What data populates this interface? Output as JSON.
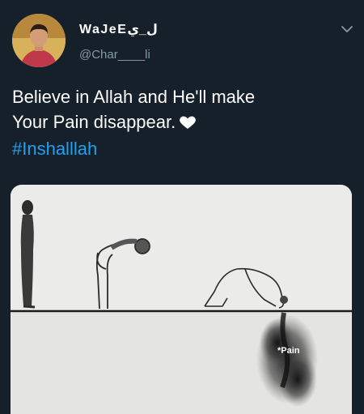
{
  "tweet": {
    "display_name": "WaJeEل_ي",
    "handle": "@Char____li",
    "text_line_1": "Believe in Allah and He'll make",
    "text_line_2": "Your Pain disappear.",
    "hashtag": "#Inshalllah",
    "heart_icon": "heart-icon",
    "menu_icon": "chevron-down-icon"
  },
  "media": {
    "pain_label": "*Pain"
  },
  "colors": {
    "background": "#15202b",
    "text": "#ffffff",
    "muted": "#8899a6",
    "link": "#1da1f2"
  }
}
